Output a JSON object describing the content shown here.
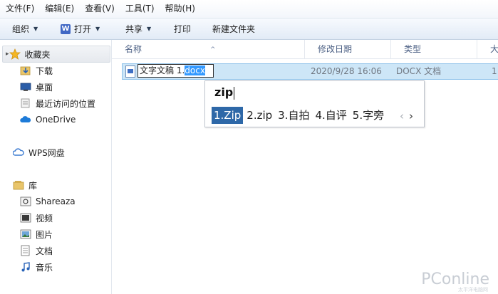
{
  "menu": [
    "文件(F)",
    "编辑(E)",
    "查看(V)",
    "工具(T)",
    "帮助(H)"
  ],
  "toolbar": {
    "organize": "组织",
    "open": "打开",
    "share": "共享",
    "burn": "打印",
    "new_folder": "新建文件夹"
  },
  "nav": {
    "favorites": "收藏夹",
    "downloads": "下载",
    "desktop": "桌面",
    "recent": "最近访问的位置",
    "onedrive": "OneDrive",
    "wps": "WPS网盘",
    "libraries": "库",
    "shareaza": "Shareaza",
    "videos": "视频",
    "pictures": "图片",
    "documents": "文档",
    "music": "音乐"
  },
  "columns": {
    "name": "名称",
    "modified": "修改日期",
    "type": "类型",
    "size": "大小"
  },
  "file": {
    "name_prefix": "文字文稿 1.",
    "name_selected": "docx",
    "modified": "2020/9/28 16:06",
    "type": "DOCX 文档",
    "size_partial": "1"
  },
  "ime": {
    "composition": "zip",
    "candidates": [
      "1.Zip",
      "2.zip",
      "3.自拍",
      "4.自评",
      "5.字旁"
    ],
    "prev": "‹",
    "next": "›"
  },
  "watermark": {
    "brand": "PConline",
    "sub": "太平洋电脑网"
  }
}
